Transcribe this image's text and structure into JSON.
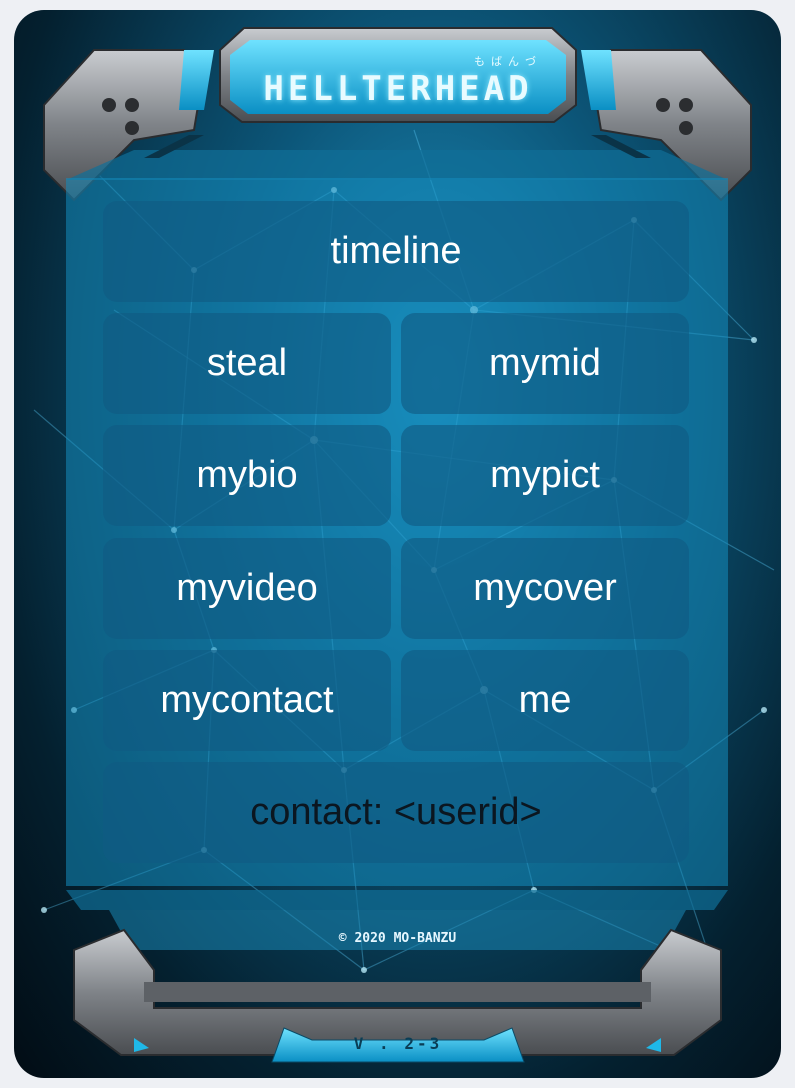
{
  "app": {
    "title": "HELLTERHEAD",
    "subtitle_kana": "もばんづ",
    "copyright": "© 2020 MO-BANZU",
    "version": "V . 2-3"
  },
  "menu": {
    "items": [
      {
        "label": "timeline"
      },
      {
        "label": "steal"
      },
      {
        "label": "mymid"
      },
      {
        "label": "mybio"
      },
      {
        "label": "mypict"
      },
      {
        "label": "myvideo"
      },
      {
        "label": "mycover"
      },
      {
        "label": "mycontact"
      },
      {
        "label": "me"
      },
      {
        "label": "contact: <userid>"
      }
    ]
  },
  "colors": {
    "accent": "#1fb8e8",
    "panel": "#148cbe",
    "frame_metal": "#8a8d91",
    "button_bg": "#105a82"
  },
  "icons": [
    "circuit-frame-top",
    "circuit-frame-bottom",
    "network-background"
  ]
}
